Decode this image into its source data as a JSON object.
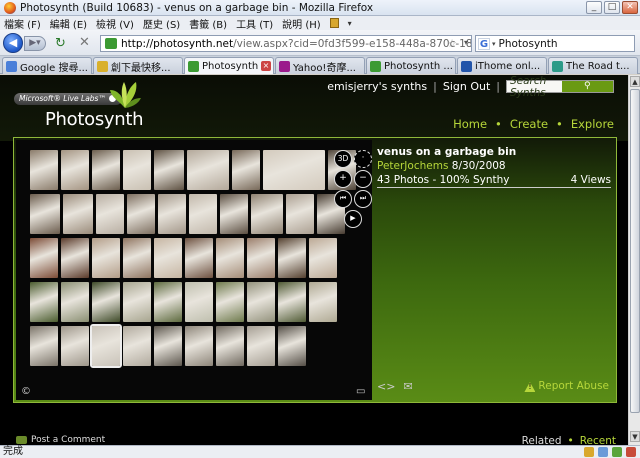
{
  "window": {
    "title": "Photosynth (Build 10683) - venus on a garbage bin - Mozilla Firefox",
    "buttons": [
      "_",
      "□",
      "✕"
    ]
  },
  "menu": [
    "檔案 (F)",
    "編輯 (E)",
    "檢視 (V)",
    "歷史 (S)",
    "書籤 (B)",
    "工具 (T)",
    "說明 (H)"
  ],
  "nav": {
    "url_domain": "http://photosynth.net",
    "url_path": "/view.aspx?cid=0fd3f599-e158-448a-870c-183c",
    "search_value": "Photosynth",
    "search_engine": "G"
  },
  "tabs": [
    {
      "label": "Google 搜尋...",
      "color": "#4a7fd9",
      "active": false
    },
    {
      "label": "創下最快移...",
      "color": "#d9b02c",
      "active": false
    },
    {
      "label": "Photosynth ...",
      "color": "#3c9a33",
      "active": true
    },
    {
      "label": "Yahoo!奇摩...",
      "color": "#9b1a8c",
      "active": false
    },
    {
      "label": "Photosynth ...",
      "color": "#3c9a33",
      "active": false
    },
    {
      "label": "iThome onl...",
      "color": "#2255aa",
      "active": false
    },
    {
      "label": "The Road t...",
      "color": "#2c9a88",
      "active": false
    }
  ],
  "site": {
    "livelabs": "Microsoft® Live Labs™",
    "brand": "Photosynth",
    "user_link": "emisjerry's synths",
    "signout": "Sign Out",
    "search_placeholder": "Search Synths",
    "topnav": [
      "Home",
      "Create",
      "Explore"
    ]
  },
  "synth": {
    "title": "venus on a garbage bin",
    "author": "PeterJochems",
    "date": "8/30/2008",
    "stats": "43 Photos - 100% Synthy",
    "views": "4 Views",
    "report": "Report Abuse",
    "viewer_controls": [
      "3D",
      "+",
      "−",
      "⏮",
      "⏭",
      "▶"
    ]
  },
  "thumbnails": {
    "rows": [
      [
        "#8a7b6a",
        "#a49482",
        "#6b5d4d",
        "#c9c0b2",
        "#5e5142",
        "#b3a89a",
        "#776858",
        "#d3cabd",
        "#4e4337"
      ],
      [
        "#6a5b4c",
        "#9a8b7a",
        "#b8aea2",
        "#7d6e5f",
        "#a39789",
        "#c2b8ab",
        "#5b4e41",
        "#8e8171",
        "#ab9f91",
        "#473c31"
      ],
      [
        "#7c4b36",
        "#5a3a2a",
        "#b39d88",
        "#8f7460",
        "#c6b5a2",
        "#6e5140",
        "#a58d78",
        "#9b7e6b",
        "#54402f",
        "#bca995"
      ],
      [
        "#4a5c2e",
        "#8a8f72",
        "#3e4a28",
        "#a7a58f",
        "#5d6a3e",
        "#bfbfae",
        "#6e7a4c",
        "#93927c",
        "#4f5a34",
        "#afa993"
      ],
      [
        "#7a7368",
        "#9e968a",
        "#c9c3b9",
        "#b1aa9e",
        "#5c564d",
        "#8d8579",
        "#6f685e",
        "#a59e93",
        "#544e46"
      ]
    ],
    "selected_row": 4,
    "selected_col": 2
  },
  "bottom": {
    "post_comment": "Post a Comment",
    "related": "Related",
    "recent": "Recent"
  },
  "status": {
    "text": "完成"
  },
  "colors": {
    "accent_green": "#b6d63a"
  }
}
